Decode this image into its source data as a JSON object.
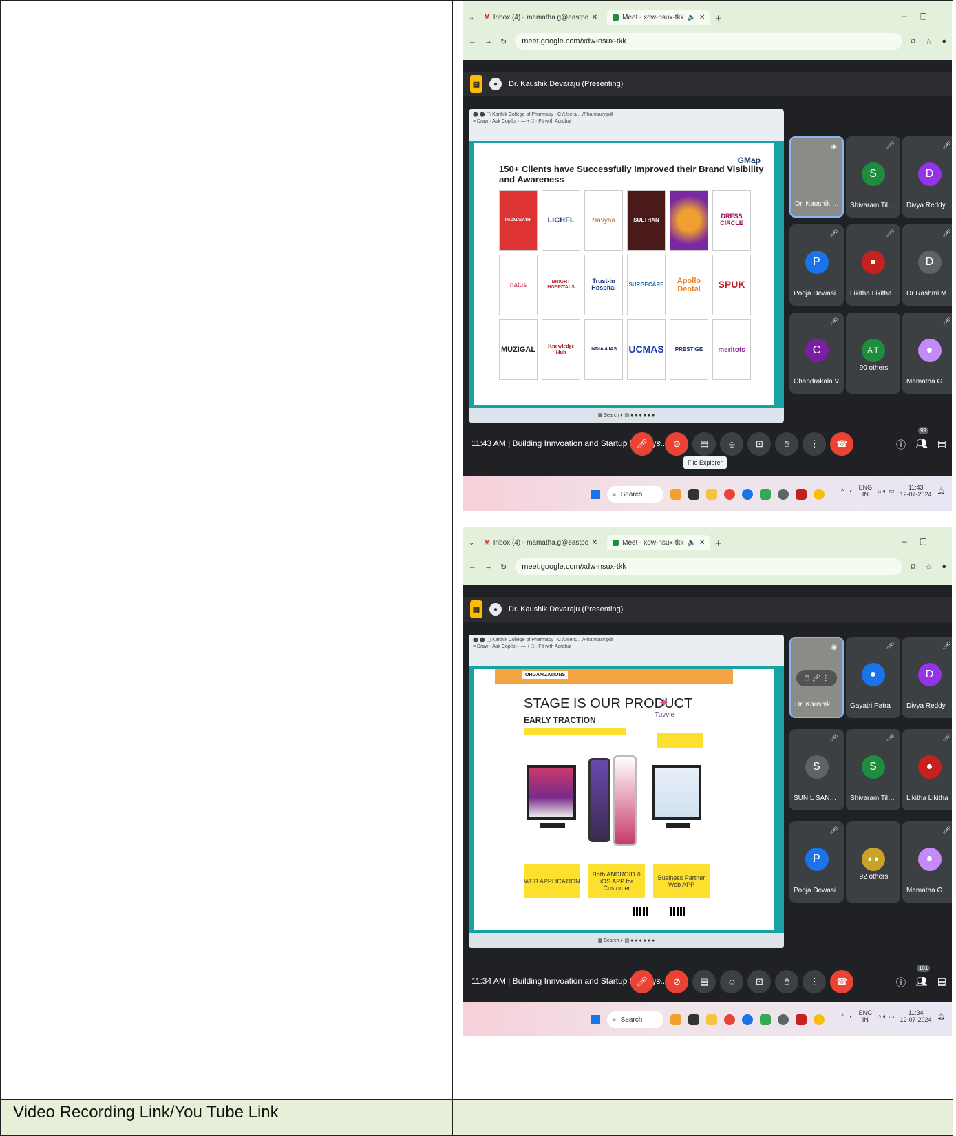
{
  "shot1": {
    "tabs": [
      {
        "label": "Inbox (4) - mamatha.g@eastpc"
      },
      {
        "label": "Meet - xdw-nsux-tkk"
      }
    ],
    "url": "meet.google.com/xdw-nsux-tkk",
    "presenter": "Dr. Kaushik Devaraju (Presenting)",
    "slide_title": "150+ Clients have Successfully Improved their Brand Visibility and Awareness",
    "logos": [
      "PADMAVATHI",
      "LICHFL",
      "Navyaa",
      "SULTHAN",
      "",
      "DRESS CIRCLE",
      "natus",
      "BRIGHT HOSPITALS",
      "Trust-in Hospital",
      "SURGECARE",
      "Apollo Dental",
      "SPUK",
      "MUZIGAL",
      "Knowledge Hub",
      "INDIA 4 IAS",
      "UCMAS",
      "PRESTIGE",
      "meritots"
    ],
    "participants": [
      {
        "name": "Dr. Kaushik Dev...",
        "initial": "",
        "color": "#8b8b88"
      },
      {
        "name": "Shivaram Tilagul",
        "initial": "S",
        "color": "#1e8e3e"
      },
      {
        "name": "Divya Reddy",
        "initial": "D",
        "color": "#9334e6"
      },
      {
        "name": "Pooja Dewasi",
        "initial": "P",
        "color": "#1a73e8"
      },
      {
        "name": "Likitha Likitha",
        "initial": "",
        "color": "#c5221f"
      },
      {
        "name": "Dr Rashmi Math...",
        "initial": "D",
        "color": "#5f6368"
      },
      {
        "name": "Chandrakala V",
        "initial": "C",
        "color": "#7b1fa2"
      },
      {
        "name": "90 others",
        "initial": "",
        "color": "#3c4043"
      },
      {
        "name": "Mamatha G",
        "initial": "",
        "color": "#c58af9"
      }
    ],
    "time": "11:43 AM",
    "meeting": "Building Innvoation and Startup Eco-Sys...",
    "tooltip": "File Explorer",
    "badge": "99",
    "clock": "11:43",
    "date": "12-07-2024"
  },
  "shot2": {
    "tabs": [
      {
        "label": "Inbox (4) - mamatha.g@eastpc"
      },
      {
        "label": "Meet - xdw-nsux-tkk"
      }
    ],
    "url": "meet.google.com/xdw-nsux-tkk",
    "presenter": "Dr. Kaushik Devaraju (Presenting)",
    "slide_header": "ORGANIZATIONS",
    "slide_title": "STAGE IS OUR PRODUCT",
    "slide_sub": "EARLY TRACTION",
    "brand": "Tuvvie",
    "boxes": [
      "WEB APPLICATION",
      "Both ANDROID & iOS APP for Customer",
      "Business Partner Web APP"
    ],
    "participants": [
      {
        "name": "Dr. Kaushik Dev...",
        "initial": "",
        "color": "#8b8b88"
      },
      {
        "name": "Gayatri Patra",
        "initial": "",
        "color": "#1a73e8"
      },
      {
        "name": "Divya Reddy",
        "initial": "D",
        "color": "#9334e6"
      },
      {
        "name": "SUNIL SANGAM...",
        "initial": "S",
        "color": "#5f6368"
      },
      {
        "name": "Shivaram Tilagul",
        "initial": "S",
        "color": "#1e8e3e"
      },
      {
        "name": "Likitha Likitha",
        "initial": "",
        "color": "#c5221f"
      },
      {
        "name": "Pooja Dewasi",
        "initial": "P",
        "color": "#1a73e8"
      },
      {
        "name": "92 others",
        "initial": "",
        "color": "#3c4043"
      },
      {
        "name": "Mamatha G",
        "initial": "",
        "color": "#c58af9"
      }
    ],
    "time": "11:34 AM",
    "meeting": "Building Innvoation and Startup Eco-Sys...",
    "badge": "101",
    "clock": "11:34",
    "date": "12-07-2024"
  },
  "common": {
    "search": "Search",
    "lang": "ENG",
    "region": "IN"
  },
  "table": {
    "label": "Video Recording Link/You Tube Link"
  }
}
